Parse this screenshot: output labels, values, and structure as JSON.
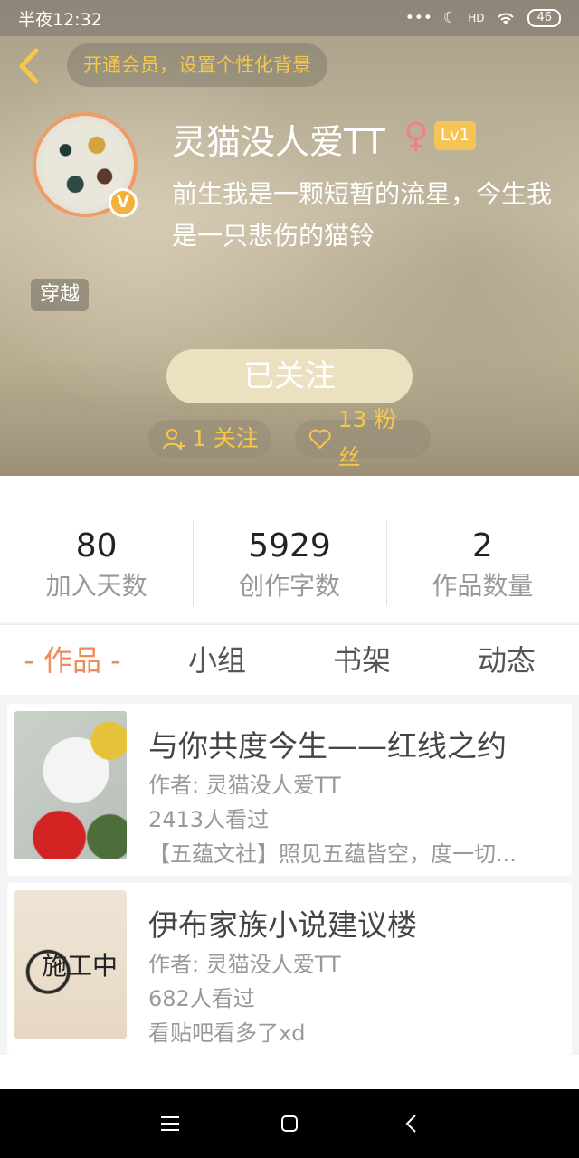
{
  "status_bar": {
    "time": "半夜12:32",
    "signal": "HD",
    "battery": "46"
  },
  "header": {
    "vip_prompt": "开通会员，设置个性化背景",
    "username": "灵猫没人爱TT",
    "gender_symbol": "♀",
    "level": "Lv1",
    "verified_badge": "V",
    "bio": "前生我是一颗短暂的流星，今生我是一只悲伤的猫铃",
    "tag": "穿越",
    "follow_button": "已关注",
    "following_chip": "1 关注",
    "fans_chip": "13 粉丝"
  },
  "stats": [
    {
      "value": "80",
      "label": "加入天数"
    },
    {
      "value": "5929",
      "label": "创作字数"
    },
    {
      "value": "2",
      "label": "作品数量"
    }
  ],
  "tabs": {
    "works": "- 作品 -",
    "group": "小组",
    "bookshelf": "书架",
    "activity": "动态"
  },
  "works": [
    {
      "title": "与你共度今生——红线之约",
      "author": "作者: 灵猫没人爱TT",
      "views": "2413人看过",
      "description": "【五蕴文社】照见五蕴皆空，度一切..."
    },
    {
      "title": "伊布家族小说建议楼",
      "author": "作者: 灵猫没人爱TT",
      "views": "682人看过",
      "description": "看贴吧看多了xd",
      "cover_text": "施工中"
    }
  ],
  "colors": {
    "accent": "#ef8a5a",
    "vip_gold": "#f5c84a",
    "avatar_ring": "#ee9b66"
  }
}
